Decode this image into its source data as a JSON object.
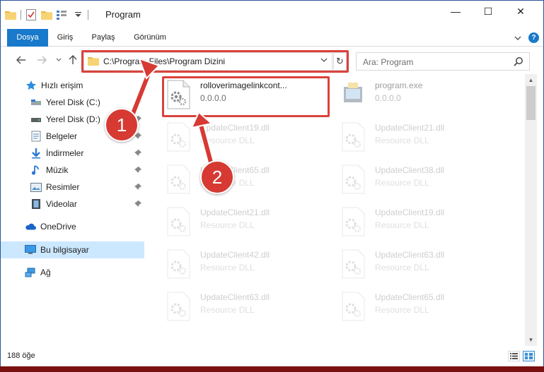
{
  "window": {
    "title": "Program",
    "controls": {
      "minimize": "—",
      "maximize": "☐",
      "close": "✕"
    }
  },
  "ribbon": {
    "tabs": [
      {
        "label": "Dosya"
      },
      {
        "label": "Giriş"
      },
      {
        "label": "Paylaş"
      },
      {
        "label": "Görünüm"
      }
    ],
    "help": "?"
  },
  "navigation": {
    "address": "C:\\Program Files\\Program Dizini",
    "search_placeholder": "Ara: Program"
  },
  "sidebar": {
    "items": [
      {
        "label": "Hızlı erişim",
        "icon": "star-icon"
      },
      {
        "label": "Yerel Disk (C:)",
        "icon": "drive-icon",
        "pinned": true
      },
      {
        "label": "Yerel Disk (D:)",
        "icon": "drive-icon",
        "pinned": true
      },
      {
        "label": "Belgeler",
        "icon": "documents-icon",
        "pinned": true
      },
      {
        "label": "İndirmeler",
        "icon": "download-icon",
        "pinned": true
      },
      {
        "label": "Müzik",
        "icon": "music-icon",
        "pinned": true
      },
      {
        "label": "Resimler",
        "icon": "pictures-icon",
        "pinned": true
      },
      {
        "label": "Videolar",
        "icon": "video-icon",
        "pinned": true
      },
      {
        "label": "OneDrive",
        "icon": "cloud-icon"
      },
      {
        "label": "Bu bilgisayar",
        "icon": "computer-icon",
        "selected": true
      },
      {
        "label": "Ağ",
        "icon": "network-icon"
      }
    ]
  },
  "files": {
    "featured": {
      "name": "rolloverimagelinkcont...",
      "sub": "0.0.0.0"
    },
    "program": {
      "name": "program.exe",
      "sub": "0.0.0.0"
    },
    "tiles": [
      {
        "name": "UpdateClient19.dll",
        "sub": "Resource DLL"
      },
      {
        "name": "UpdateClient21.dll",
        "sub": "Resource DLL"
      },
      {
        "name": "UpdateClient65.dll",
        "sub": "Resource DLL"
      },
      {
        "name": "UpdateClient38.dll",
        "sub": "Resource DLL"
      },
      {
        "name": "UpdateClient21.dll",
        "sub": "Resource DLL"
      },
      {
        "name": "UpdateClient19.dll",
        "sub": "Resource DLL"
      },
      {
        "name": "UpdateClient42.dll",
        "sub": "Resource DLL"
      },
      {
        "name": "UpdateClient63.dll",
        "sub": "Resource DLL"
      },
      {
        "name": "UpdateClient63.dll",
        "sub": "Resource DLL"
      },
      {
        "name": "UpdateClient65.dll",
        "sub": "Resource DLL"
      }
    ]
  },
  "status": {
    "item_count": "188 öğe"
  },
  "annotations": {
    "step1": "1",
    "step2": "2"
  },
  "colors": {
    "accent": "#1979ca",
    "highlight": "#d9423c",
    "selection": "#cce8ff"
  }
}
